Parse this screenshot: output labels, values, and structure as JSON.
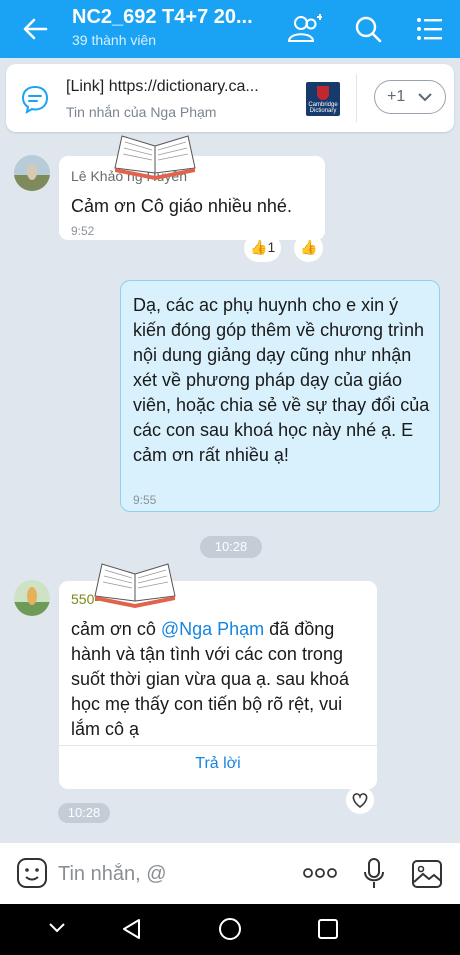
{
  "header": {
    "title": "NC2_692 T4+7 20...",
    "subtitle": "39 thành viên"
  },
  "pinned": {
    "link_text": "[Link] https://dictionary.ca...",
    "from_text": "Tin nhắn của Nga Phạm",
    "thumb_text": "Cambridge Dictionary",
    "more_label": "+1"
  },
  "messages": [
    {
      "sender": "Lê Khảo          ng Huyền",
      "text": "Cảm ơn Cô giáo nhiều nhé.",
      "time": "9:52",
      "reactions": [
        {
          "icon": "thumbs-up-icon",
          "count": "1"
        },
        {
          "icon": "thumbs-up-icon",
          "count": ""
        }
      ]
    },
    {
      "text": "Dạ, các ac phụ huynh cho e xin ý kiến đóng góp thêm về chương trình nội dung giảng dạy cũng như nhận xét về phương pháp dạy của giáo viên, hoặc chia sẻ về sự thay đổi của các con sau khoá học này nhé ạ. E cảm ơn rất nhiều ạ!",
      "time": "9:55"
    },
    {
      "sender": "550-",
      "text_before": "cảm ơn cô ",
      "mention": "@Nga Phạm",
      "text_after": " đã đồng hành và tận tình với các con trong suốt thời gian vừa qua ạ. sau khoá học mẹ thấy con tiến bộ rõ rệt, vui lắm cô ạ",
      "reply_label": "Trả lời",
      "time": "10:28"
    }
  ],
  "date_separator": "10:28",
  "composer": {
    "placeholder": "Tin nhắn, @"
  },
  "colors": {
    "header": "#1aa3f5",
    "sent_bubble": "#d8f1fd",
    "link": "#1785e0"
  }
}
